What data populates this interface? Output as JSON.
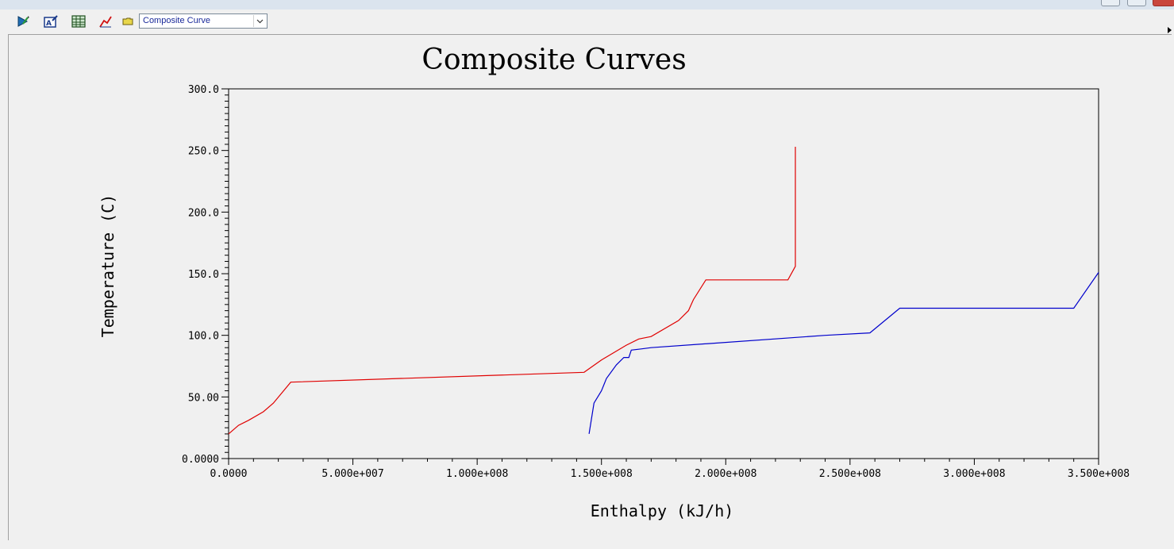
{
  "toolbar": {
    "curve_selector_value": "Composite Curve"
  },
  "icons": [
    "edit-graph-icon",
    "graph-properties-icon",
    "table-view-icon",
    "cursor-icon",
    "folder-icon"
  ],
  "colors": {
    "hot_curve": "#e00000",
    "cold_curve": "#0000cc",
    "background": "#f0f0f0"
  },
  "chart_data": {
    "type": "line",
    "title": "Composite Curves",
    "xlabel": "Enthalpy (kJ/h)",
    "ylabel": "Temperature (C)",
    "xlim": [
      0,
      350000000
    ],
    "ylim": [
      0,
      300
    ],
    "x_ticks": [
      0,
      50000000,
      100000000,
      150000000,
      200000000,
      250000000,
      300000000,
      350000000
    ],
    "x_tick_labels": [
      "0.0000",
      "5.000e+007",
      "1.000e+008",
      "1.500e+008",
      "2.000e+008",
      "2.500e+008",
      "3.000e+008",
      "3.500e+008"
    ],
    "y_ticks": [
      0,
      50,
      100,
      150,
      200,
      250,
      300
    ],
    "y_tick_labels": [
      "0.0000",
      "50.00",
      "100.0",
      "150.0",
      "200.0",
      "250.0",
      "300.0"
    ],
    "grid": false,
    "series": [
      {
        "color": "#e00000",
        "x": [
          0,
          4000000,
          8000000,
          14000000,
          18000000,
          25000000,
          143000000,
          150000000,
          160000000,
          165000000,
          170000000,
          181000000,
          185000000,
          187000000,
          192000000,
          225000000,
          228000000,
          228000000
        ],
        "y": [
          20,
          27,
          31,
          38,
          45,
          62,
          70,
          80,
          92,
          97,
          99,
          112,
          120,
          129,
          145,
          145,
          156,
          253
        ]
      },
      {
        "color": "#0000cc",
        "x": [
          145000000,
          147000000,
          150000000,
          152000000,
          156000000,
          159000000,
          161000000,
          162000000,
          166000000,
          170000000,
          240000000,
          258000000,
          270000000,
          340000000,
          350000000
        ],
        "y": [
          20,
          45,
          55,
          65,
          76,
          82,
          82,
          88,
          89,
          90,
          100,
          102,
          122,
          122,
          151
        ]
      }
    ]
  }
}
